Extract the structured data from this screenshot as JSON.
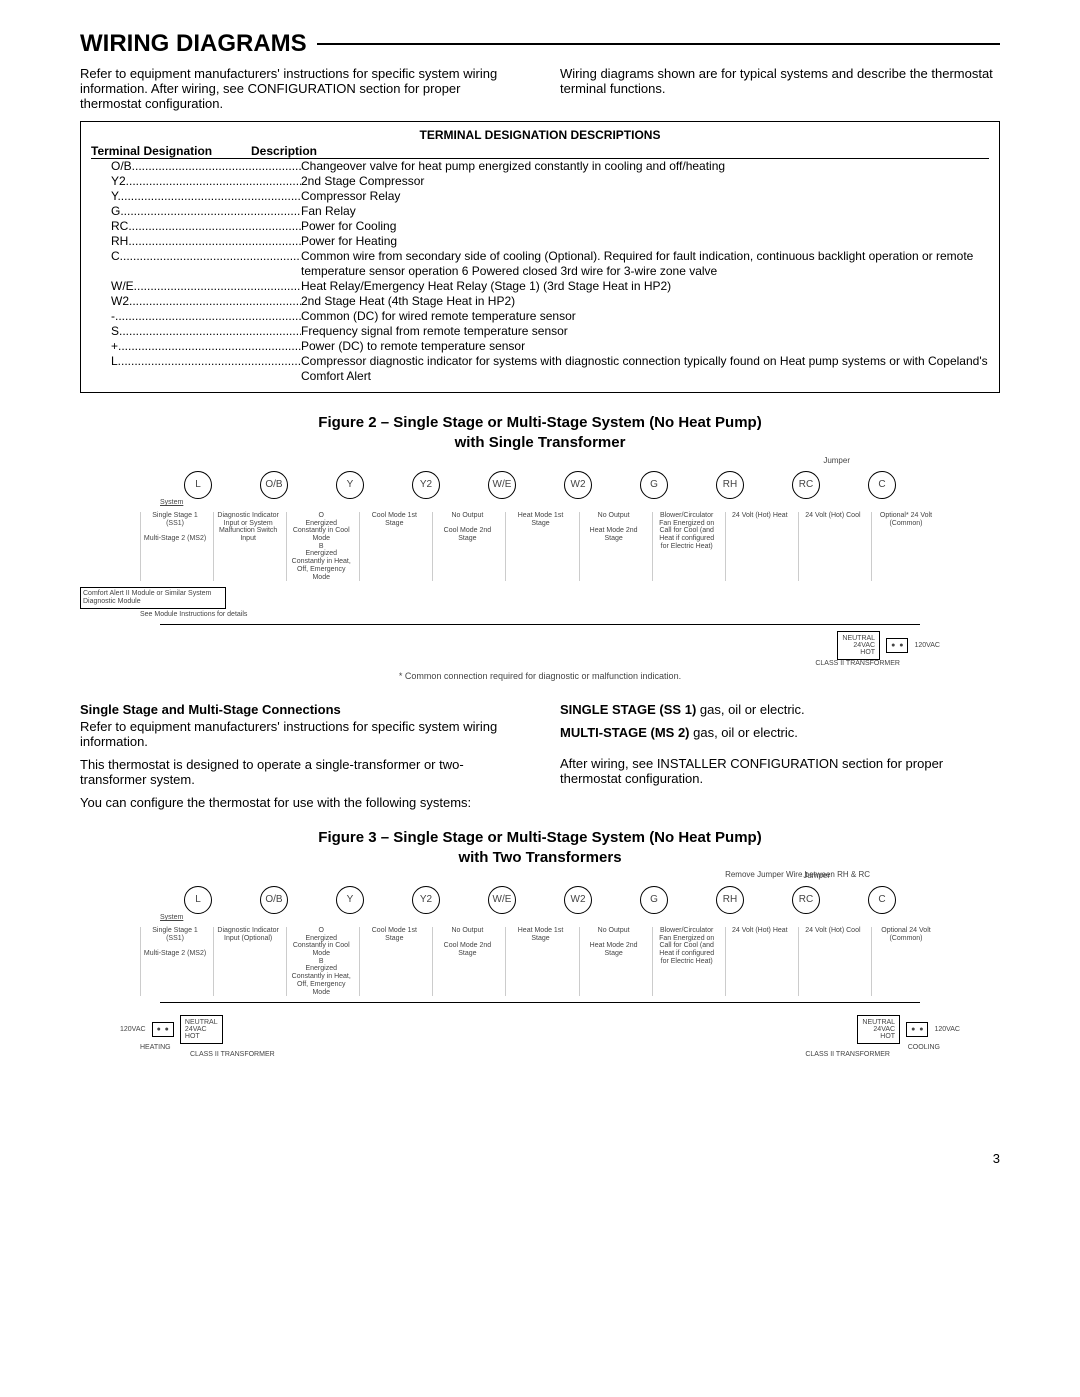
{
  "title": "WIRING DIAGRAMS",
  "intro": {
    "left": "Refer to equipment manufacturers' instructions for specific system wiring information. After wiring, see CONFIGURATION section for proper thermostat configuration.",
    "right": "Wiring diagrams shown are for typical systems and describe the thermostat terminal functions."
  },
  "table": {
    "title": "TERMINAL DESIGNATION DESCRIPTIONS",
    "col1": "Terminal Designation",
    "col2": "Description",
    "rows": [
      {
        "term": "O/B",
        "desc": "Changeover valve for heat pump energized constantly in cooling and off/heating"
      },
      {
        "term": "Y2",
        "desc": "2nd Stage Compressor"
      },
      {
        "term": "Y",
        "desc": "Compressor Relay"
      },
      {
        "term": "G",
        "desc": "Fan Relay"
      },
      {
        "term": "RC",
        "desc": "Power for Cooling"
      },
      {
        "term": "RH",
        "desc": "Power for Heating"
      },
      {
        "term": "C",
        "desc": "Common wire from secondary side of cooling (Optional). Required for fault indication, continuous backlight operation or remote temperature sensor operation 6 Powered closed 3rd wire for 3-wire zone valve"
      },
      {
        "term": "W/E",
        "desc": "Heat Relay/Emergency Heat Relay (Stage 1) (3rd Stage Heat in HP2)"
      },
      {
        "term": "W2",
        "desc": "2nd Stage Heat (4th Stage Heat in HP2)"
      },
      {
        "term": "-",
        "desc": "Common (DC) for wired remote temperature sensor"
      },
      {
        "term": "S",
        "desc": "Frequency signal from remote temperature sensor"
      },
      {
        "term": "+",
        "desc": "Power (DC) to remote temperature sensor"
      },
      {
        "term": "L",
        "desc": "Compressor diagnostic indicator for systems with diagnostic connection typically found on Heat pump systems or with Copeland's Comfort Alert"
      }
    ]
  },
  "figure2": {
    "title_line1": "Figure 2 – Single Stage or Multi-Stage System (No Heat Pump)",
    "title_line2": "with Single Transformer",
    "terminals": [
      "L",
      "O/B",
      "Y",
      "Y2",
      "W/E",
      "W2",
      "G",
      "RH",
      "RC",
      "C"
    ],
    "jumper": "Jumper",
    "systems_header": "System",
    "systems_l": "Single Stage 1 (SS1)\n\nMulti-Stage 2 (MS2)",
    "diag_input": "Diagnostic Indicator Input or System Malfunction Switch Input",
    "ob_desc": "O\nEnergized Constantly in Cool Mode\nB\nEnergized Constantly in Heat, Off, Emergency Mode",
    "y_desc": "Cool Mode 1st Stage",
    "y2_desc": "No Output\n\nCool Mode 2nd Stage",
    "we_desc": "Heat Mode 1st Stage",
    "w2_desc": "No Output\n\nHeat Mode 2nd Stage",
    "g_desc": "Blower/Circulator Fan Energized on Call for Cool (and Heat if configured for Electric Heat)",
    "rh_desc": "24 Volt (Hot) Heat",
    "rc_desc": "24 Volt (Hot) Cool",
    "c_desc": "Optional* 24 Volt (Common)",
    "comfort_alert": "Comfort Alert II Module or Similar System Diagnostic Module",
    "module_note": "See Module Instructions for details",
    "common_note": "* Common connection required for diagnostic or malfunction indication.",
    "xfmr": {
      "neutral": "NEUTRAL",
      "v24": "24VAC",
      "hot": "HOT",
      "v120": "120VAC",
      "label": "CLASS II TRANSFORMER"
    }
  },
  "mid": {
    "left_heading": "Single Stage and Multi-Stage Connections",
    "left_p1": "Refer to equipment manufacturers' instructions for specific system wiring information.",
    "left_p2": "This thermostat is designed to operate a single-transformer or two-transformer system.",
    "left_p3": "You can configure the thermostat for use with the following systems:",
    "right_p1a": "SINGLE STAGE (SS 1)",
    "right_p1b": " gas, oil or electric.",
    "right_p2a": "MULTI-STAGE (MS 2)",
    "right_p2b": " gas, oil or electric.",
    "right_p3": "After wiring, see INSTALLER CONFIGURATION section for proper thermostat configuration."
  },
  "figure3": {
    "title_line1": "Figure 3 – Single Stage or Multi-Stage System (No Heat Pump)",
    "title_line2": "with Two Transformers",
    "remove_jumper": "Remove Jumper Wire between RH & RC",
    "terminals": [
      "L",
      "O/B",
      "Y",
      "Y2",
      "W/E",
      "W2",
      "G",
      "RH",
      "RC",
      "C"
    ],
    "jumper": "Jumper",
    "systems_header": "System",
    "systems_l": "Single Stage 1 (SS1)\n\nMulti-Stage 2 (MS2)",
    "diag_input": "Diagnostic Indicator Input (Optional)",
    "ob_desc": "O\nEnergized Constantly in Cool Mode\nB\nEnergized Constantly in Heat, Off, Emergency Mode",
    "y_desc": "Cool Mode 1st Stage",
    "y2_desc": "No Output\n\nCool Mode 2nd Stage",
    "we_desc": "Heat Mode 1st Stage",
    "w2_desc": "No Output\n\nHeat Mode 2nd Stage",
    "g_desc": "Blower/Circulator Fan Energized on Call for Cool (and Heat if configured for Electric Heat)",
    "rh_desc": "24 Volt (Hot) Heat",
    "rc_desc": "24 Volt (Hot) Cool",
    "c_desc": "Optional 24 Volt (Common)",
    "xfmr_left": {
      "neutral": "NEUTRAL",
      "v24": "24VAC",
      "hot": "HOT",
      "v120": "120VAC",
      "side": "HEATING",
      "label": "CLASS II TRANSFORMER"
    },
    "xfmr_right": {
      "neutral": "NEUTRAL",
      "v24": "24VAC",
      "hot": "HOT",
      "v120": "120VAC",
      "side": "COOLING",
      "label": "CLASS II TRANSFORMER"
    }
  },
  "page_number": "3"
}
